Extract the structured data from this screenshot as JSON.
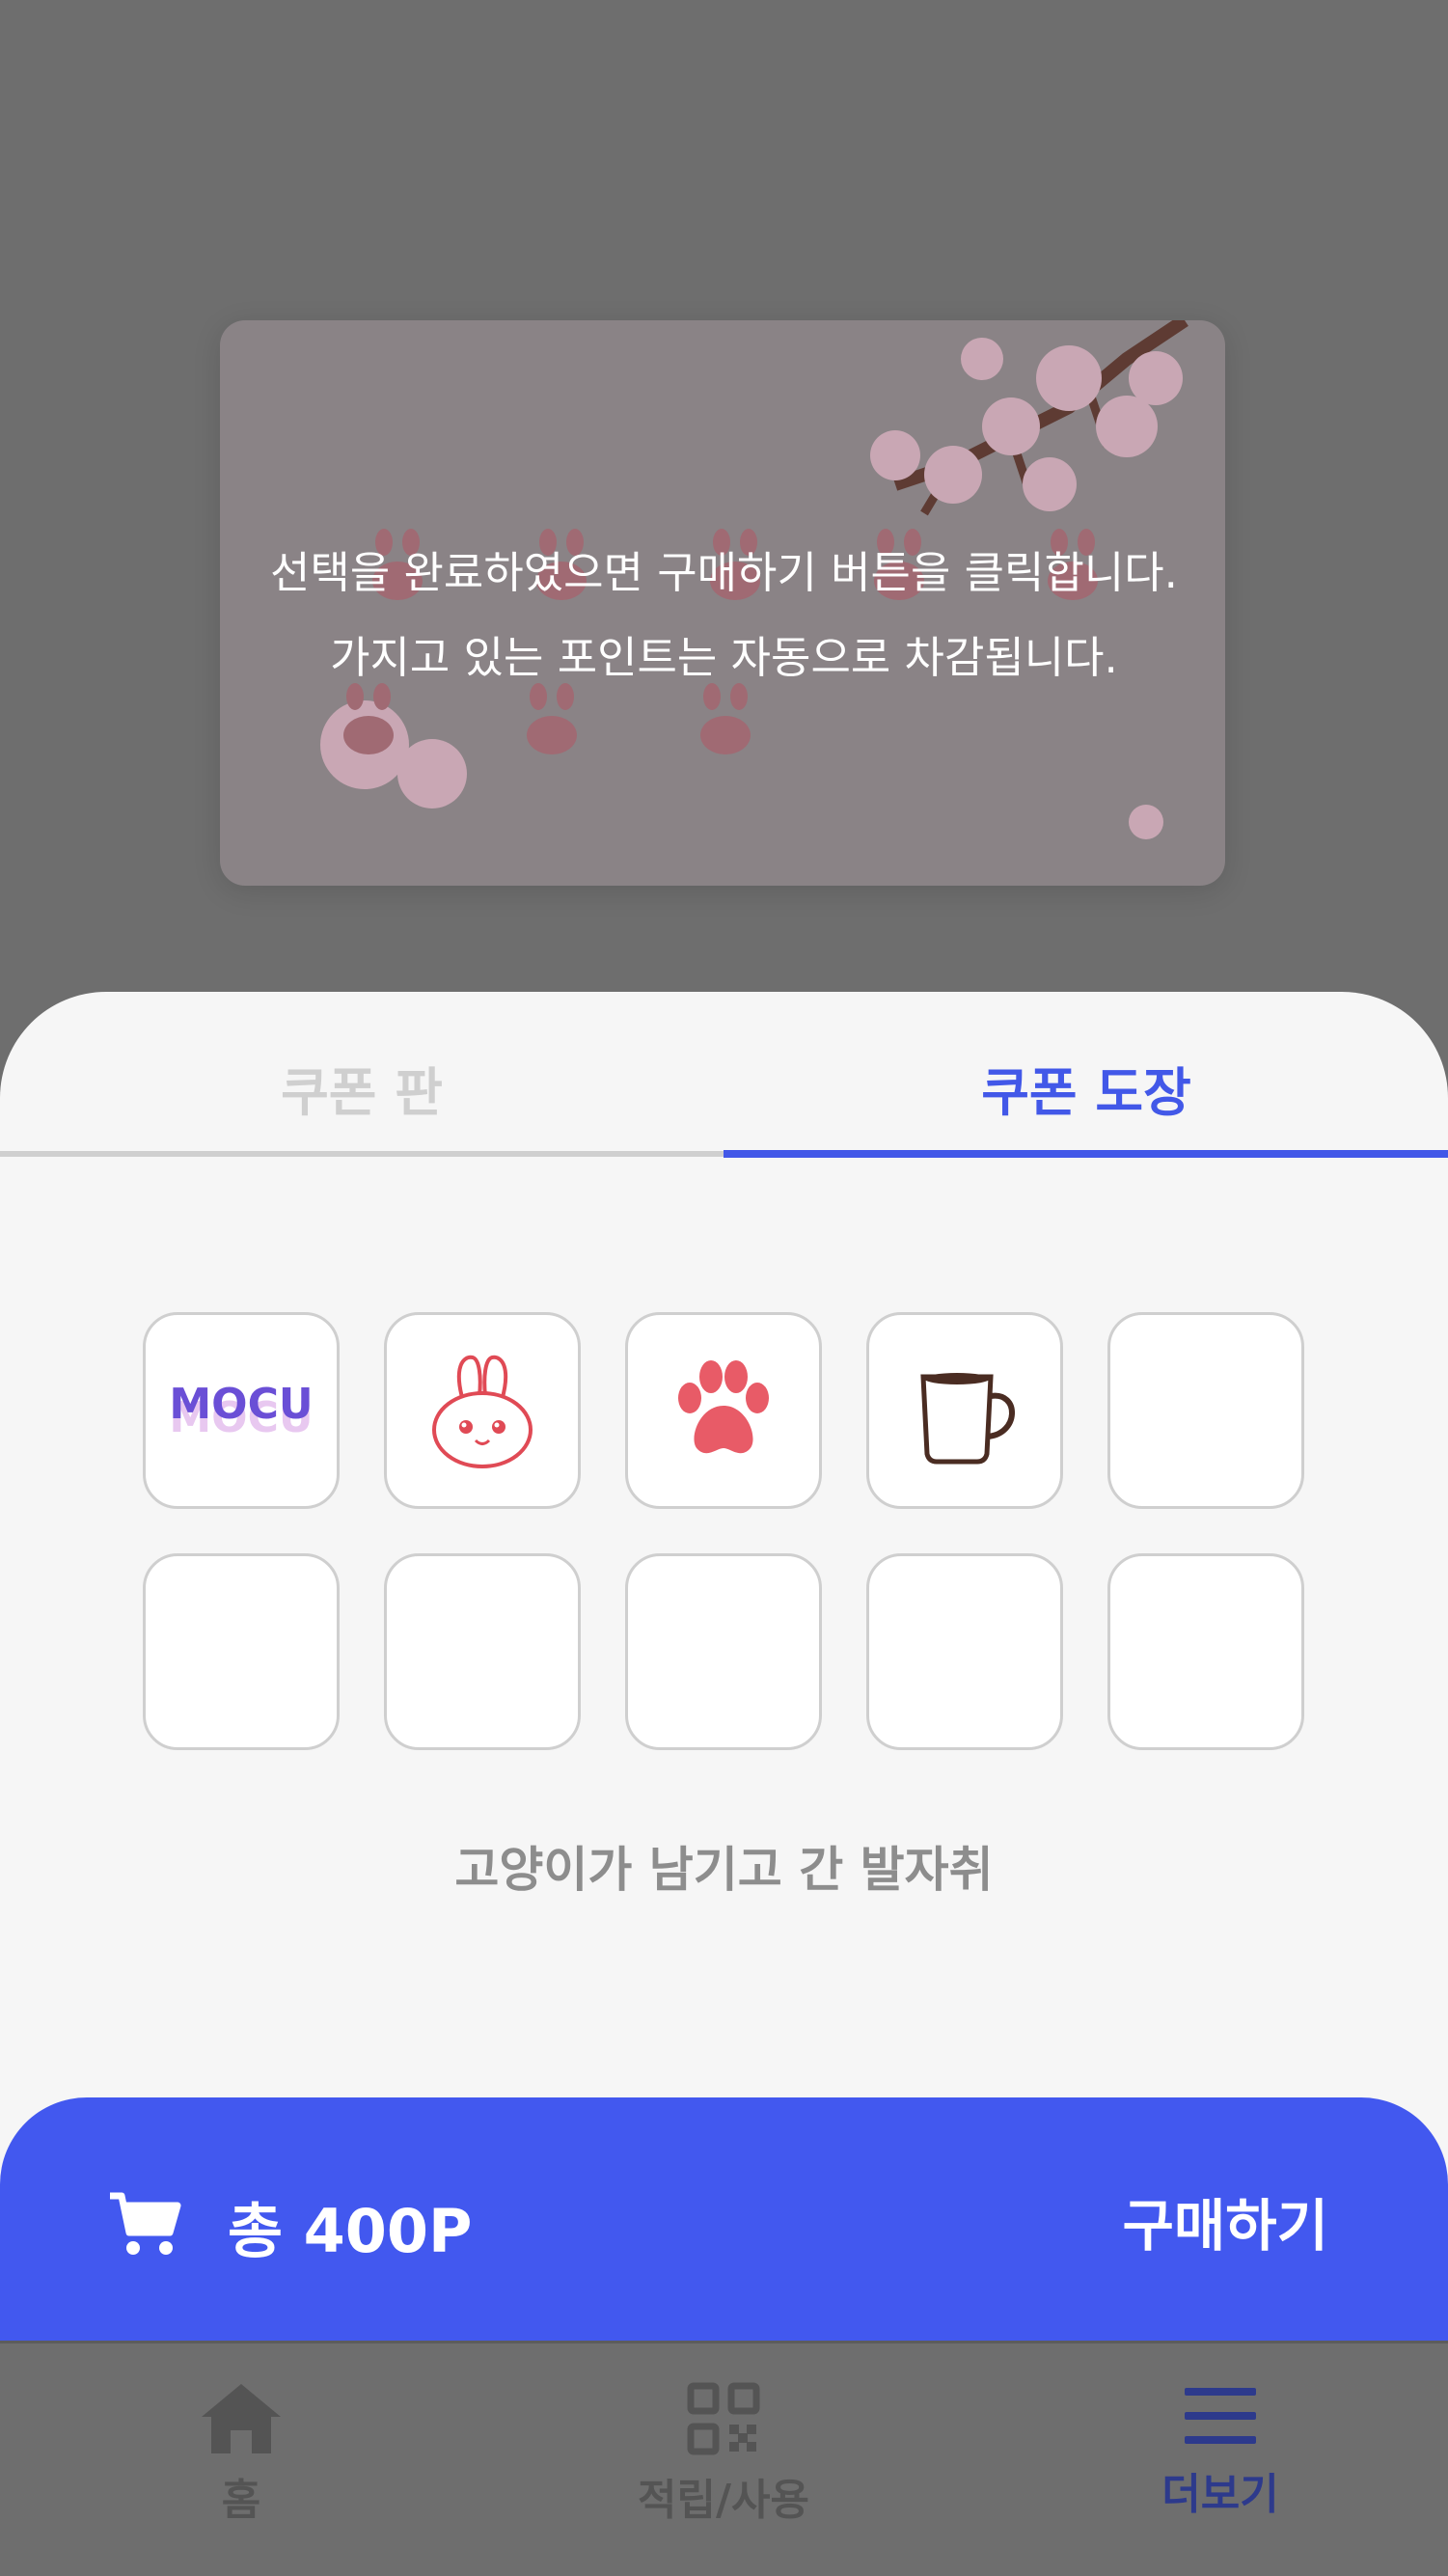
{
  "guide": {
    "line1": "선택을 완료하였으면 구매하기 버튼을 클릭합니다.",
    "line2": "가지고 있는 포인트는 자동으로 차감됩니다."
  },
  "tabs": [
    {
      "label": "쿠폰 판",
      "active": false
    },
    {
      "label": "쿠폰 도장",
      "active": true
    }
  ],
  "stamps": {
    "items": [
      {
        "icon": "mocu-logo-icon",
        "logo_text": "MOCU"
      },
      {
        "icon": "bunny-face-icon"
      },
      {
        "icon": "paw-print-icon"
      },
      {
        "icon": "coffee-mug-icon"
      },
      {
        "icon": ""
      },
      {
        "icon": ""
      },
      {
        "icon": ""
      },
      {
        "icon": ""
      },
      {
        "icon": ""
      },
      {
        "icon": ""
      }
    ],
    "caption": "고양이가 남기고 간 발자취"
  },
  "purchase": {
    "total": "총 400P",
    "buy_label": "구매하기"
  },
  "nav": {
    "items": [
      {
        "label": "홈",
        "icon": "home-icon"
      },
      {
        "label": "적립/사용",
        "icon": "qr-code-icon"
      },
      {
        "label": "더보기",
        "icon": "menu-icon",
        "active": true
      }
    ]
  },
  "colors": {
    "accent": "#4258ef",
    "overlay": "#6e6e6e",
    "sheet": "#f6f6f6",
    "inactive_tab": "#cfcfcf"
  }
}
